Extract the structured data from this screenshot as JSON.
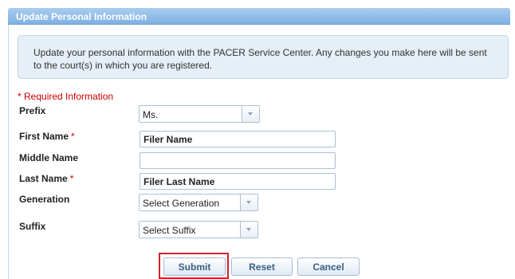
{
  "panel": {
    "title": "Update Personal Information"
  },
  "intro": "Update your personal information with the PACER Service Center. Any changes you make here will be sent to the court(s) in which you are registered.",
  "required_note": "* Required Information",
  "form": {
    "prefix": {
      "label": "Prefix",
      "value": "Ms."
    },
    "first_name": {
      "label": "First Name",
      "required_mark": "*",
      "value": "Filer Name"
    },
    "middle_name": {
      "label": "Middle Name",
      "value": ""
    },
    "last_name": {
      "label": "Last Name",
      "required_mark": "*",
      "value": "Filer Last Name"
    },
    "generation": {
      "label": "Generation",
      "value": "Select Generation"
    },
    "suffix": {
      "label": "Suffix",
      "value": "Select Suffix"
    }
  },
  "buttons": {
    "submit": "Submit",
    "reset": "Reset",
    "cancel": "Cancel"
  },
  "colors": {
    "required": "#cc0000",
    "highlight": "#d2232a",
    "header": "#8fbbe9"
  }
}
